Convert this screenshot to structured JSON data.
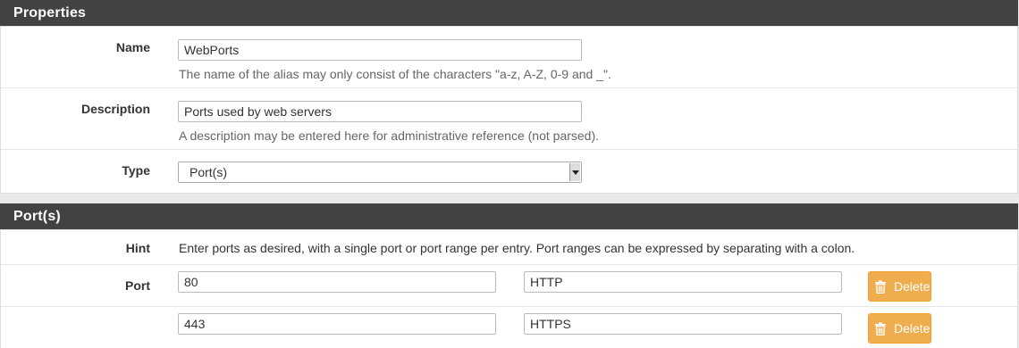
{
  "properties": {
    "heading": "Properties",
    "name": {
      "label": "Name",
      "value": "WebPorts",
      "help": "The name of the alias may only consist of the characters \"a-z, A-Z, 0-9 and _\"."
    },
    "description": {
      "label": "Description",
      "value": "Ports used by web servers",
      "help": "A description may be entered here for administrative reference (not parsed)."
    },
    "type": {
      "label": "Type",
      "selected": "Port(s)"
    }
  },
  "ports": {
    "heading": "Port(s)",
    "hint_label": "Hint",
    "hint_text": "Enter ports as desired, with a single port or port range per entry. Port ranges can be expressed by separating with a colon.",
    "port_label": "Port",
    "delete_label": "Delete",
    "delete_icon": "trash-icon",
    "entries": [
      {
        "port": "80",
        "description": "HTTP"
      },
      {
        "port": "443",
        "description": "HTTPS"
      }
    ]
  },
  "colors": {
    "heading_bg": "#424242",
    "delete_button": "#f0ad4e"
  }
}
